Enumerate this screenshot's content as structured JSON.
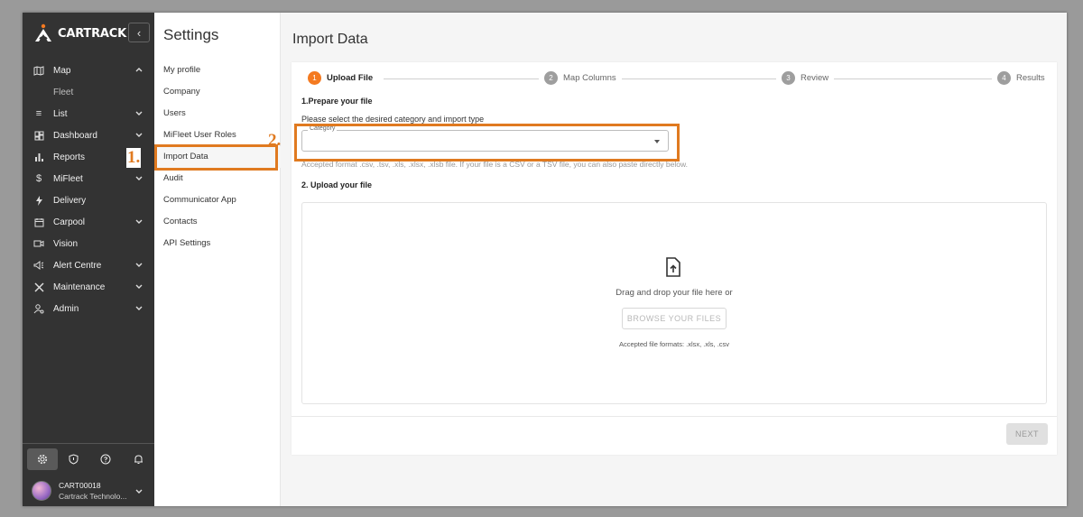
{
  "brand": {
    "logo_text": "CARTRACK",
    "accent": "#f47a20"
  },
  "sidebar": {
    "collapse_icon": "chevron-left-icon",
    "items": [
      {
        "label": "Map",
        "icon": "map-icon",
        "chevron": "up"
      },
      {
        "label": "Fleet",
        "icon": "",
        "sub": true
      },
      {
        "label": "List",
        "icon": "list-icon",
        "chevron": "down"
      },
      {
        "label": "Dashboard",
        "icon": "dashboard-icon",
        "chevron": "down"
      },
      {
        "label": "Reports",
        "icon": "bar-chart-icon"
      },
      {
        "label": "MiFleet",
        "icon": "dollar-icon",
        "chevron": "down"
      },
      {
        "label": "Delivery",
        "icon": "bolt-icon"
      },
      {
        "label": "Carpool",
        "icon": "calendar-icon",
        "chevron": "down"
      },
      {
        "label": "Vision",
        "icon": "camera-icon"
      },
      {
        "label": "Alert Centre",
        "icon": "megaphone-icon",
        "chevron": "down"
      },
      {
        "label": "Maintenance",
        "icon": "tools-icon",
        "chevron": "down"
      },
      {
        "label": "Admin",
        "icon": "admin-icon",
        "chevron": "down"
      }
    ],
    "user": {
      "id": "CART00018",
      "company": "Cartrack Technolo..."
    }
  },
  "settings": {
    "title": "Settings",
    "menu": [
      "My profile",
      "Company",
      "Users",
      "MiFleet User Roles",
      "Import Data",
      "Audit",
      "Communicator App",
      "Contacts",
      "API Settings"
    ],
    "active": "Import Data"
  },
  "main": {
    "title": "Import Data",
    "steps": [
      {
        "num": "1",
        "label": "Upload File",
        "active": true
      },
      {
        "num": "2",
        "label": "Map Columns",
        "active": false
      },
      {
        "num": "3",
        "label": "Review",
        "active": false
      },
      {
        "num": "4",
        "label": "Results",
        "active": false
      }
    ],
    "prepare_title": "1.Prepare your file",
    "instruction": "Please select the desired category and import type",
    "category_label": "Category",
    "category_value": "",
    "helper": "Accepted format .csv, .tsv, .xls, .xlsx, .xlsb file. If your file is a CSV or a TSV file, you can also paste directly below.",
    "upload_title": "2. Upload your file",
    "dropzone_text": "Drag and drop your file here or",
    "browse_label": "BROWSE YOUR FILES",
    "formats": "Accepted file formats: .xlsx, .xls, .csv",
    "next_label": "NEXT"
  },
  "annotations": {
    "one": "1.",
    "two": "2.",
    "color": "#e07a20"
  }
}
